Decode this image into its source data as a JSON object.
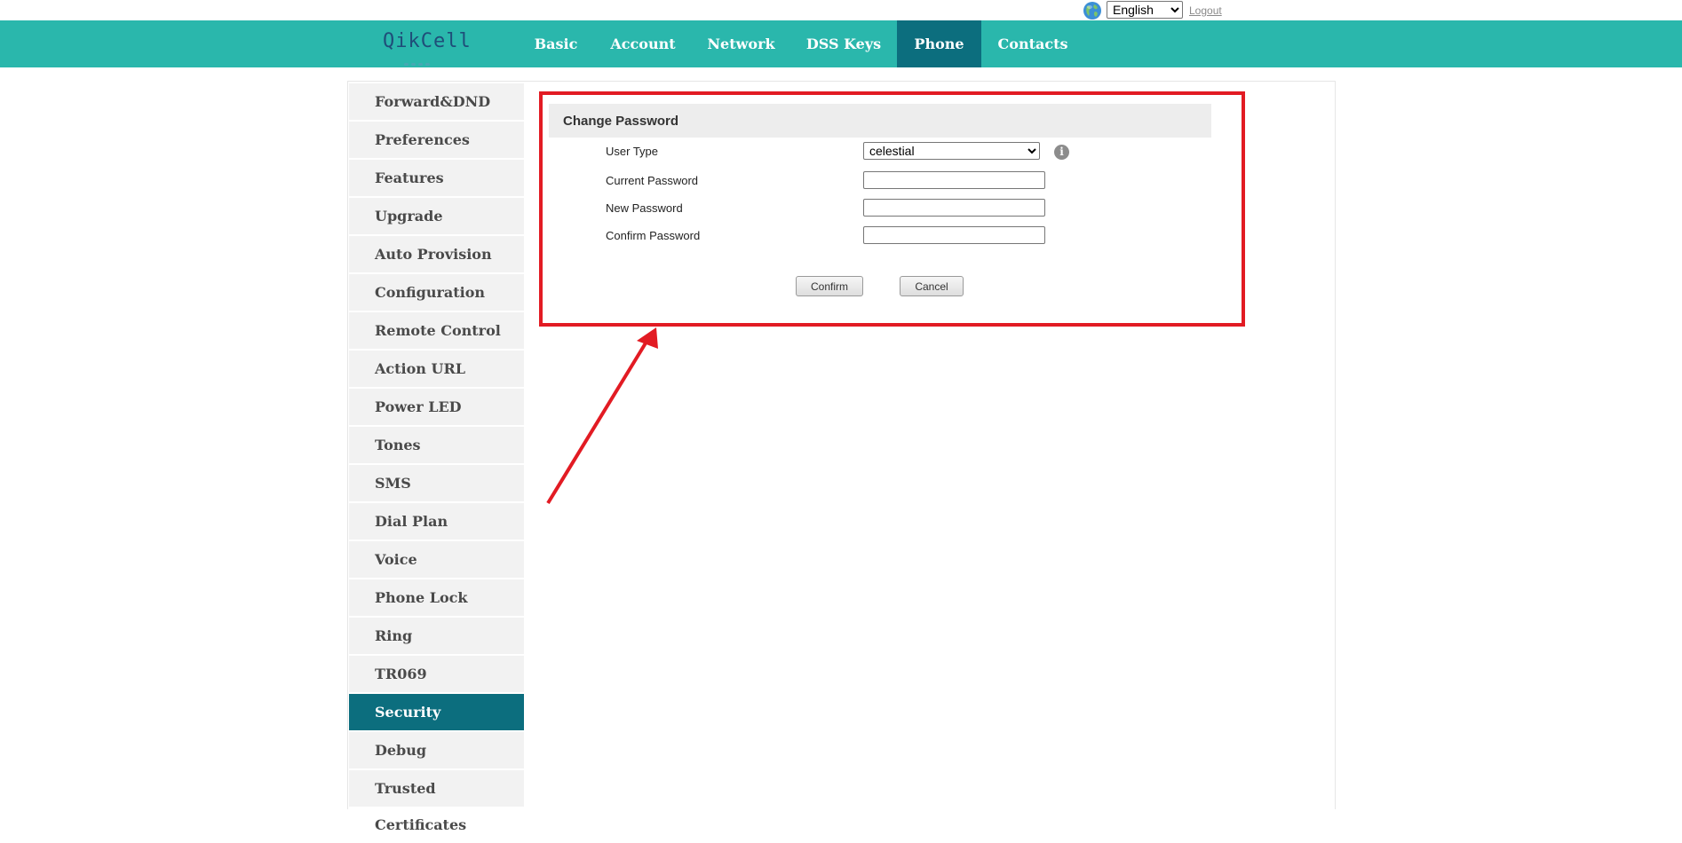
{
  "topbar": {
    "language": "English",
    "language_options": [
      "English"
    ],
    "logout": "Logout"
  },
  "brand": {
    "logo": "QikCell"
  },
  "nav": {
    "items": [
      {
        "label": "Basic"
      },
      {
        "label": "Account"
      },
      {
        "label": "Network"
      },
      {
        "label": "DSS Keys"
      },
      {
        "label": "Phone",
        "active": true
      },
      {
        "label": "Contacts"
      }
    ]
  },
  "sidebar": {
    "items": [
      {
        "label": "Forward&DND"
      },
      {
        "label": "Preferences"
      },
      {
        "label": "Features"
      },
      {
        "label": "Upgrade"
      },
      {
        "label": "Auto Provision"
      },
      {
        "label": "Configuration"
      },
      {
        "label": "Remote Control"
      },
      {
        "label": "Action URL"
      },
      {
        "label": "Power LED"
      },
      {
        "label": "Tones"
      },
      {
        "label": "SMS"
      },
      {
        "label": "Dial Plan"
      },
      {
        "label": "Voice"
      },
      {
        "label": "Phone Lock"
      },
      {
        "label": "Ring"
      },
      {
        "label": "TR069"
      },
      {
        "label": "Security",
        "active": true
      },
      {
        "label": "Debug"
      },
      {
        "label": "Trusted Certificates"
      }
    ]
  },
  "form": {
    "title": "Change Password",
    "user_type_label": "User Type",
    "user_type_value": "celestial",
    "user_type_options": [
      "celestial"
    ],
    "current_password_label": "Current Password",
    "current_password_value": "",
    "new_password_label": "New Password",
    "new_password_value": "",
    "confirm_password_label": "Confirm Password",
    "confirm_password_value": "",
    "info_icon": "info-icon",
    "confirm_button": "Confirm",
    "cancel_button": "Cancel"
  },
  "colors": {
    "nav_bg": "#2ab7ac",
    "active_bg": "#0c6e7e",
    "annotation": "#e21b23"
  }
}
